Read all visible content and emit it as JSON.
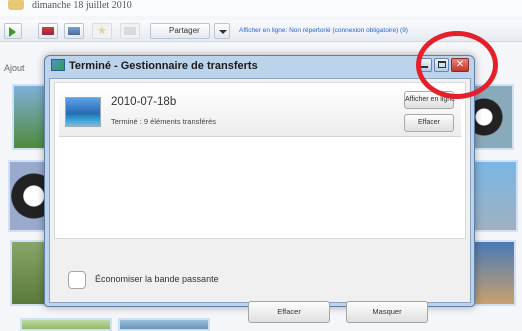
{
  "background": {
    "date": "dimanche 18 juillet 2010",
    "toolbar": {
      "share_label": "Partager",
      "online_status": "Afficher en ligne: Non répertorié (connexion obligatoire) (9)"
    },
    "section_label": "Ajout"
  },
  "dialog": {
    "title": "Terminé - Gestionnaire de transferts",
    "close_glyph": "✕",
    "transfer": {
      "name": "2010-07-18b",
      "status": "Terminé : 9 éléments transférés",
      "view_online_label": "Afficher en ligne",
      "remove_label": "Effacer"
    },
    "save_bandwidth_label": "Économiser la bande passante",
    "clear_label": "Effacer",
    "hide_label": "Masquer"
  },
  "annotation": {
    "color": "#e4202a"
  }
}
